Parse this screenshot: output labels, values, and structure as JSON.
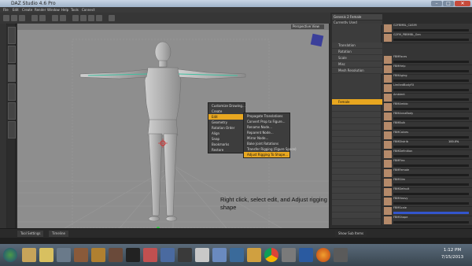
{
  "window": {
    "title": "DAZ Studio 4.6 Pro",
    "minimize": "–",
    "maximize": "□",
    "close": "✕"
  },
  "menu": [
    "File",
    "Edit",
    "Create",
    "Render",
    "Window",
    "Help",
    "Tools",
    "Connect"
  ],
  "viewport": {
    "camera_label": "Perspective View"
  },
  "context_menu": {
    "items": [
      "Customize Drawing...",
      "Create",
      "Edit",
      "Geometry",
      "Rotation Order",
      "Align",
      "Snap",
      "Bookmarks",
      "Restore"
    ],
    "highlighted": "Edit"
  },
  "edit_submenu": {
    "items": [
      "Propagate Translations",
      "Convert Prop to Figure...",
      "Rename Node...",
      "Reparent Node...",
      "Mirror Node...",
      "Bake Joint Rotations",
      "Transfer Rigging (Figure Space)",
      "Adjust Rigging To Shape..."
    ],
    "highlighted": "Adjust Rigging To Shape..."
  },
  "caption": "Right click, select edit, and Adjust rigging to shape",
  "scene_panel": {
    "header": "Genesis 2 Female",
    "filter": "Currently Used",
    "items": [
      "Translation",
      "Rotation",
      "Scale",
      "Misc",
      "Mesh Resolution",
      "Female"
    ],
    "selected": "Female"
  },
  "params_panel": {
    "items": [
      "G2FBMBL_CASIM",
      "G2FM_PBBMBL_Gen",
      "FBMFaces",
      "FBMHelp",
      "FBMAging",
      "LimitedBodyFX",
      "Ambient",
      "FBMAmbio",
      "FBMAnnaBody",
      "FBMBulk",
      "FBMCalves",
      "FBMDistrib",
      "FBMDefinition",
      "FBMFlex",
      "FBMFemale",
      "FBMSlim",
      "FBMDefault",
      "FBMHeavy",
      "FBMScale",
      "FBMShape",
      "FBMStretch",
      "FBMShape2",
      "FBMShape3",
      "FBMThin",
      "FBMVolume",
      "FBMLength"
    ],
    "value": "100.0%"
  },
  "bottom_tabs": [
    "Tool Settings",
    "Timeline"
  ],
  "bottom_right": "Show Sub Items",
  "taskbar": {
    "time": "1:12 PM",
    "date": "7/15/2013"
  },
  "colors": {
    "accent": "#e8a720",
    "viewport": "#8e8e8e",
    "panel": "#353535"
  }
}
